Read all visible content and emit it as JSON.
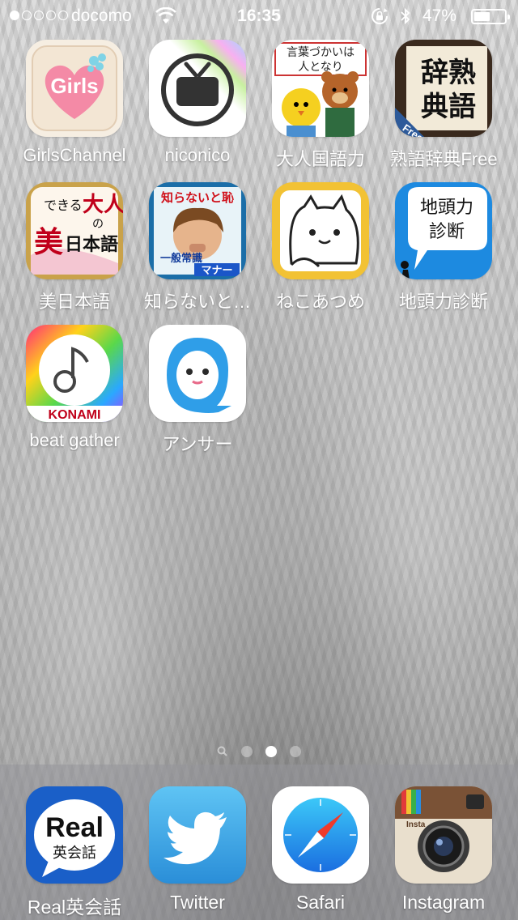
{
  "status_bar": {
    "carrier": "docomo",
    "time": "16:35",
    "battery_percent": "47%",
    "battery_level": 0.47,
    "signal_bars_filled": 1,
    "signal_bars_total": 5
  },
  "apps": [
    {
      "label": "GirlsChannel",
      "icon": "girlschannel-icon"
    },
    {
      "label": "niconico",
      "icon": "niconico-tv-icon"
    },
    {
      "label": "大人国語力",
      "icon": "otona-kokugo-icon",
      "icon_text": "言葉づかいは人となり"
    },
    {
      "label": "熟語辞典Free",
      "icon": "jukugo-dictionary-icon",
      "icon_text": "辞熟典語",
      "badge": "Free"
    },
    {
      "label": "美日本語",
      "icon": "bi-nihongo-icon",
      "icon_text": "できる大人の美日本語"
    },
    {
      "label": "知らないと…",
      "icon": "shiranaito-icon",
      "icon_text_top": "知らないと恥",
      "icon_text_mid": "一般常識",
      "icon_text_bottom": "マナー"
    },
    {
      "label": "ねこあつめ",
      "icon": "nekoatsume-cat-icon"
    },
    {
      "label": "地頭力診断",
      "icon": "jiatamaryoku-icon",
      "icon_text": "地頭力診断"
    },
    {
      "label": "beat gather",
      "icon": "beat-gather-note-icon",
      "brand": "KONAMI"
    },
    {
      "label": "アンサー",
      "icon": "answer-ghost-icon"
    }
  ],
  "dock": [
    {
      "label": "Real英会話",
      "icon": "real-eikaiwa-icon",
      "icon_text_top": "Real",
      "icon_text_bottom": "英会話"
    },
    {
      "label": "Twitter",
      "icon": "twitter-bird-icon"
    },
    {
      "label": "Safari",
      "icon": "safari-compass-icon"
    },
    {
      "label": "Instagram",
      "icon": "instagram-camera-icon",
      "icon_text": "Insta"
    }
  ],
  "pages": {
    "count": 3,
    "current": 2
  }
}
